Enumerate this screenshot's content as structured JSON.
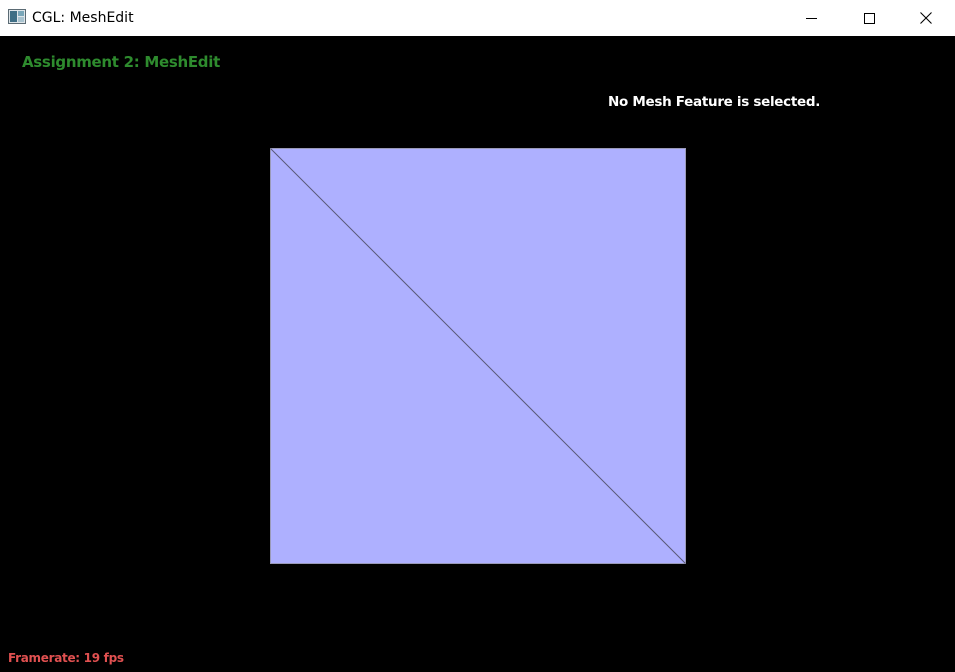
{
  "window": {
    "title": "CGL: MeshEdit",
    "buttons": {
      "minimize": "minimize-icon",
      "maximize": "maximize-icon",
      "close": "close-icon"
    }
  },
  "hud": {
    "assignment_title": "Assignment 2: MeshEdit",
    "selection_status": "No Mesh Feature is selected.",
    "framerate_label": "Framerate:",
    "framerate_value": "19 fps"
  },
  "mesh": {
    "faces": 2,
    "face_color": "#aeb0ff",
    "edge_color": "#5a5a78"
  },
  "colors": {
    "background": "#000000",
    "title_green": "#2e8b2e",
    "status_white": "#ffffff",
    "framerate_red": "#e05050"
  }
}
